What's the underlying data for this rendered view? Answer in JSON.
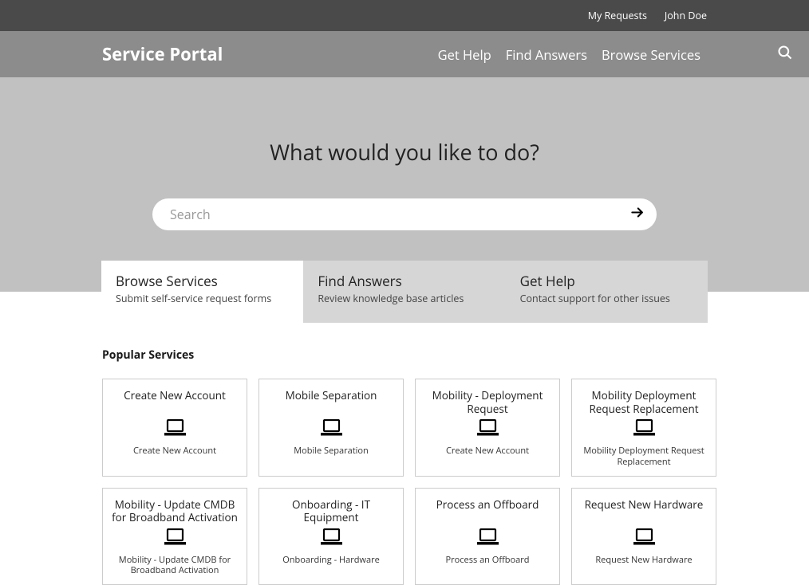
{
  "topBar": {
    "myRequests": "My Requests",
    "userName": "John Doe"
  },
  "nav": {
    "title": "Service Portal",
    "links": {
      "getHelp": "Get Help",
      "findAnswers": "Find Answers",
      "browseServices": "Browse Services"
    }
  },
  "hero": {
    "title": "What would you like to do?",
    "searchPlaceholder": "Search"
  },
  "tabs": [
    {
      "title": "Browse Services",
      "sub": "Submit self-service request forms"
    },
    {
      "title": "Find Answers",
      "sub": "Review knowledge base articles"
    },
    {
      "title": "Get Help",
      "sub": "Contact support for other issues"
    }
  ],
  "sectionTitle": "Popular Services",
  "cards": [
    {
      "title": "Create New Account",
      "sub": "Create New Account"
    },
    {
      "title": "Mobile Separation",
      "sub": "Mobile Separation"
    },
    {
      "title": "Mobility - Deployment Request",
      "sub": "Create New Account"
    },
    {
      "title": "Mobility Deployment Request Replacement",
      "sub": "Mobility Deployment Request Replacement"
    },
    {
      "title": "Mobility - Update CMDB for Broadband Activation",
      "sub": "Mobility - Update CMDB for Broadband Activation"
    },
    {
      "title": "Onboarding - IT Equipment",
      "sub": "Onboarding - Hardware"
    },
    {
      "title": "Process an Offboard",
      "sub": "Process an Offboard"
    },
    {
      "title": "Request New Hardware",
      "sub": "Request New Hardware"
    }
  ]
}
